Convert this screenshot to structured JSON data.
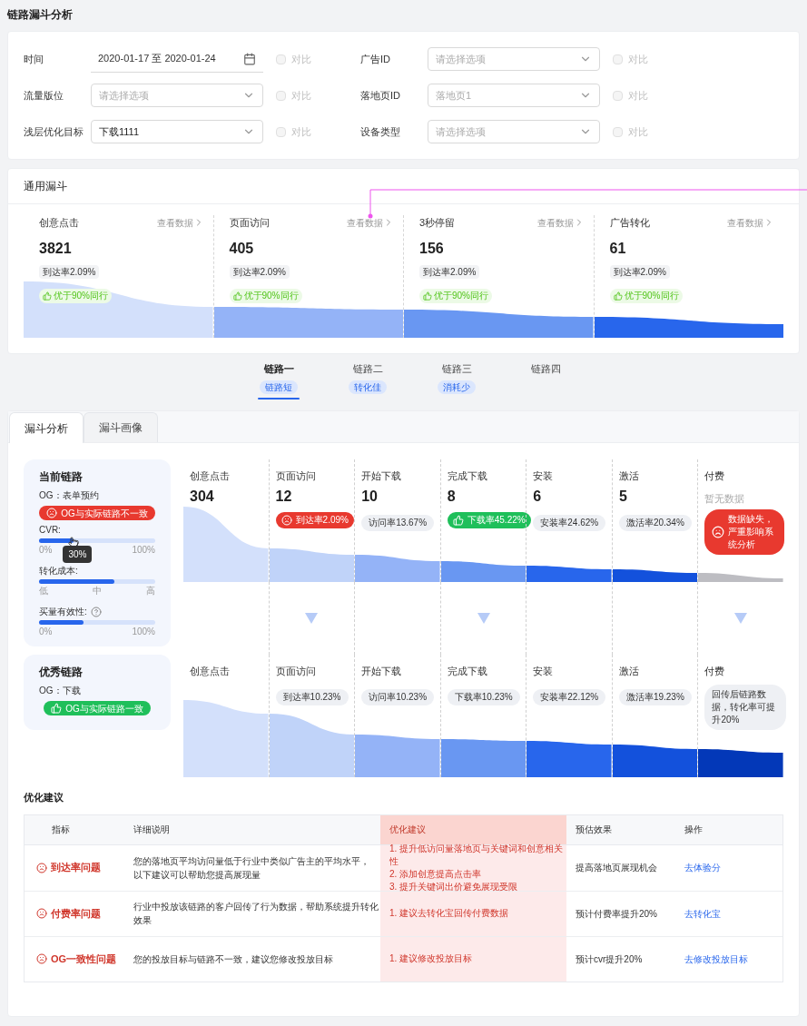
{
  "page_title": "链路漏斗分析",
  "filters": [
    {
      "label": "时间",
      "kind": "date",
      "value": "2020-01-17 至 2020-01-24",
      "compare": "对比",
      "compare_checked": false
    },
    {
      "label": "广告ID",
      "kind": "select",
      "placeholder": "请选择选项",
      "compare": "对比",
      "compare_checked": false
    },
    {
      "label": "流量版位",
      "kind": "select",
      "placeholder": "请选择选项",
      "compare": "对比",
      "compare_checked": false
    },
    {
      "label": "落地页ID",
      "kind": "select",
      "placeholder": "落地页1",
      "compare": "对比",
      "compare_checked": false
    },
    {
      "label": "浅层优化目标",
      "kind": "select",
      "value": "下载1111",
      "compare": "对比",
      "compare_checked": false
    },
    {
      "label": "设备类型",
      "kind": "select",
      "placeholder": "请选择选项",
      "compare": "对比",
      "compare_checked": false
    }
  ],
  "general_funnel": {
    "title": "通用漏斗",
    "stages": [
      {
        "name": "创意点击",
        "link": "查看数据",
        "value": "3821",
        "rate": "到达率2.09%",
        "badge": "优于90%同行"
      },
      {
        "name": "页面访问",
        "link": "查看数据",
        "value": "405",
        "rate": "到达率2.09%",
        "badge": "优于90%同行"
      },
      {
        "name": "3秒停留",
        "link": "查看数据",
        "value": "156",
        "rate": "到达率2.09%",
        "badge": "优于90%同行"
      },
      {
        "name": "广告转化",
        "link": "查看数据",
        "value": "61",
        "rate": "到达率2.09%",
        "badge": "优于90%同行"
      }
    ]
  },
  "chain_tabs": [
    {
      "label": "链路一",
      "tag": "链路短",
      "selected": true
    },
    {
      "label": "链路二",
      "tag": "转化佳",
      "selected": false
    },
    {
      "label": "链路三",
      "tag": "消耗少",
      "selected": false
    },
    {
      "label": "链路四",
      "selected": false
    }
  ],
  "tabs": [
    {
      "label": "漏斗分析",
      "selected": true
    },
    {
      "label": "漏斗画像",
      "selected": false
    }
  ],
  "current_chain": {
    "title": "当前链路",
    "og": "OG：表单预约",
    "og_status": {
      "kind": "bad",
      "text": "OG与实际链路不一致"
    },
    "meters": [
      {
        "label": "CVR:",
        "level": 0.3,
        "scale": [
          "0%",
          "100%"
        ],
        "tooltip": "30%"
      },
      {
        "label": "转化成本:",
        "level": 0.65,
        "scale": [
          "低",
          "中",
          "高"
        ]
      },
      {
        "label": "买量有效性:",
        "help": true,
        "level": 0.38,
        "scale": [
          "0%",
          "100%"
        ]
      }
    ],
    "stages": [
      {
        "name": "创意点击",
        "value": "304",
        "arrow": false
      },
      {
        "name": "页面访问",
        "value": "12",
        "kind": "bad",
        "rate": "到达率2.09%",
        "arrow": true
      },
      {
        "name": "开始下载",
        "value": "10",
        "kind": "neutral",
        "rate": "访问率13.67%",
        "arrow": false
      },
      {
        "name": "完成下载",
        "value": "8",
        "kind": "good",
        "rate": "下载率45.22%",
        "arrow": true
      },
      {
        "name": "安装",
        "value": "6",
        "kind": "neutral",
        "rate": "安装率24.62%",
        "arrow": false
      },
      {
        "name": "激活",
        "value": "5",
        "kind": "neutral",
        "rate": "激活率20.34%",
        "arrow": false
      },
      {
        "name": "付费",
        "value": "暂无数据",
        "no_data": true,
        "kind": "alert",
        "rate": "数据缺失，严重影响系统分析",
        "arrow": true
      }
    ]
  },
  "excellent_chain": {
    "title": "优秀链路",
    "og": "OG：下载",
    "og_status": {
      "kind": "good",
      "text": "OG与实际链路一致"
    },
    "stages": [
      {
        "name": "创意点击"
      },
      {
        "name": "页面访问",
        "kind": "neutral",
        "rate": "到达率10.23%"
      },
      {
        "name": "开始下载",
        "kind": "neutral",
        "rate": "访问率10.23%"
      },
      {
        "name": "完成下载",
        "kind": "neutral",
        "rate": "下载率10.23%"
      },
      {
        "name": "安装",
        "kind": "neutral",
        "rate": "安装率22.12%"
      },
      {
        "name": "激活",
        "kind": "neutral",
        "rate": "激活率19.23%"
      },
      {
        "name": "付费",
        "kind": "note",
        "rate": "回传后链路数据，转化率可提升20%"
      }
    ]
  },
  "suggestions": {
    "title": "优化建议",
    "columns": [
      {
        "label": "指标",
        "highlighted": false
      },
      {
        "label": "详细说明",
        "highlighted": false
      },
      {
        "label": "优化建议",
        "highlighted": true
      },
      {
        "label": "预估效果",
        "highlighted": false
      },
      {
        "label": "操作",
        "highlighted": false
      }
    ],
    "rows": [
      {
        "metric": "到达率问题",
        "description": [
          "您的落地页平均访问量低于行业中类似广告主的平均水平，",
          "以下建议可以帮助您提高展现量"
        ],
        "advice": [
          "1. 提升低访问量落地页与关键词和创意相关性",
          "2. 添加创意提高点击率",
          "3. 提升关键词出价避免展现受限"
        ],
        "effect": "提高落地页展现机会",
        "action": "去体验分"
      },
      {
        "metric": "付费率问题",
        "description": [
          "行业中投放该链路的客户回传了行为数据，帮助系统提升转化效果"
        ],
        "advice": [
          "1. 建议去转化宝回传付费数据"
        ],
        "effect": "预计付费率提升20%",
        "action": "去转化宝"
      },
      {
        "metric": "OG一致性问题",
        "description": [
          "您的投放目标与链路不一致，建议您修改投放目标"
        ],
        "advice": [
          "1. 建议修改投放目标"
        ],
        "effect": "预计cvr提升20%",
        "action": "去修改投放目标"
      }
    ]
  }
}
